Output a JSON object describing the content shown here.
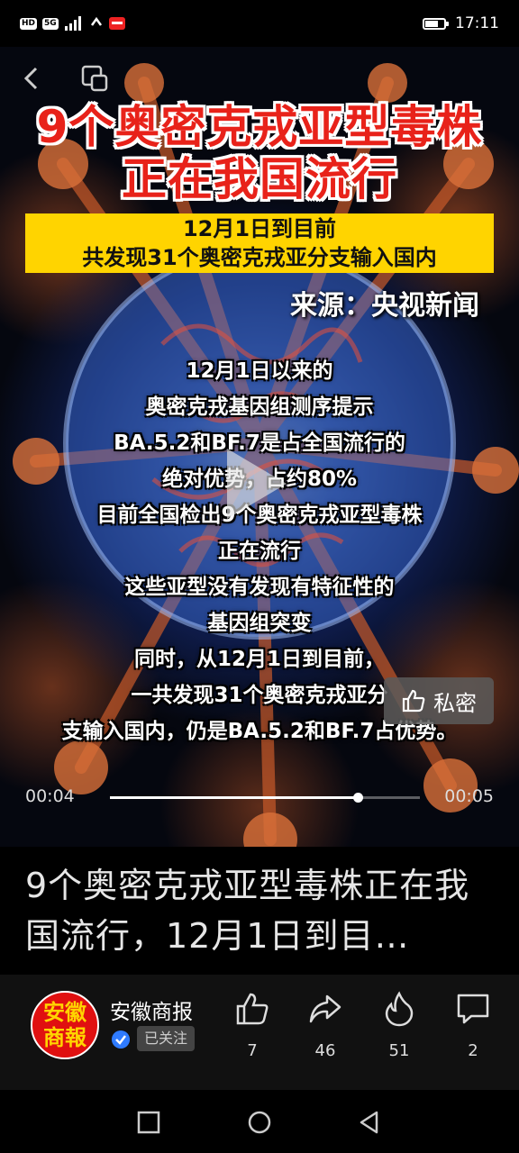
{
  "status_bar": {
    "left_chips": [
      "HD",
      "5G"
    ],
    "time": "17:11"
  },
  "video": {
    "headline_line1": "9个奥密克戎亚型毒株",
    "headline_line2": "正在我国流行",
    "highlight_line1": "12月1日到目前",
    "highlight_line2": "共发现31个奥密克戎亚分支输入国内",
    "source": "来源：央视新闻",
    "body_lines": [
      "12月1日以来的",
      "奥密克戎基因组测序提示",
      "BA.5.2和BF.7是占全国流行的",
      "绝对优势，占约80%",
      "目前全国检出9个奥密克戎亚型毒株",
      "正在流行",
      "这些亚型没有发现有特征性的",
      "基因组突变",
      "同时，从12月1日到目前，",
      "一共发现31个奥密克戎亚分",
      "支输入国内，仍是BA.5.2和BF.7占优势。"
    ],
    "like_private_label": "私密",
    "current_time": "00:04",
    "total_time": "00:05",
    "progress_fraction": 0.8
  },
  "caption": "9个奥密克戎亚型毒株正在我国流行，12月1日到目…",
  "account": {
    "avatar_text_top": "安徽",
    "avatar_text_bottom": "商報",
    "name": "安徽商报",
    "follow_status": "已关注"
  },
  "actions": {
    "like_count": "7",
    "share_count": "46",
    "hot_count": "51",
    "comment_count": "2"
  }
}
